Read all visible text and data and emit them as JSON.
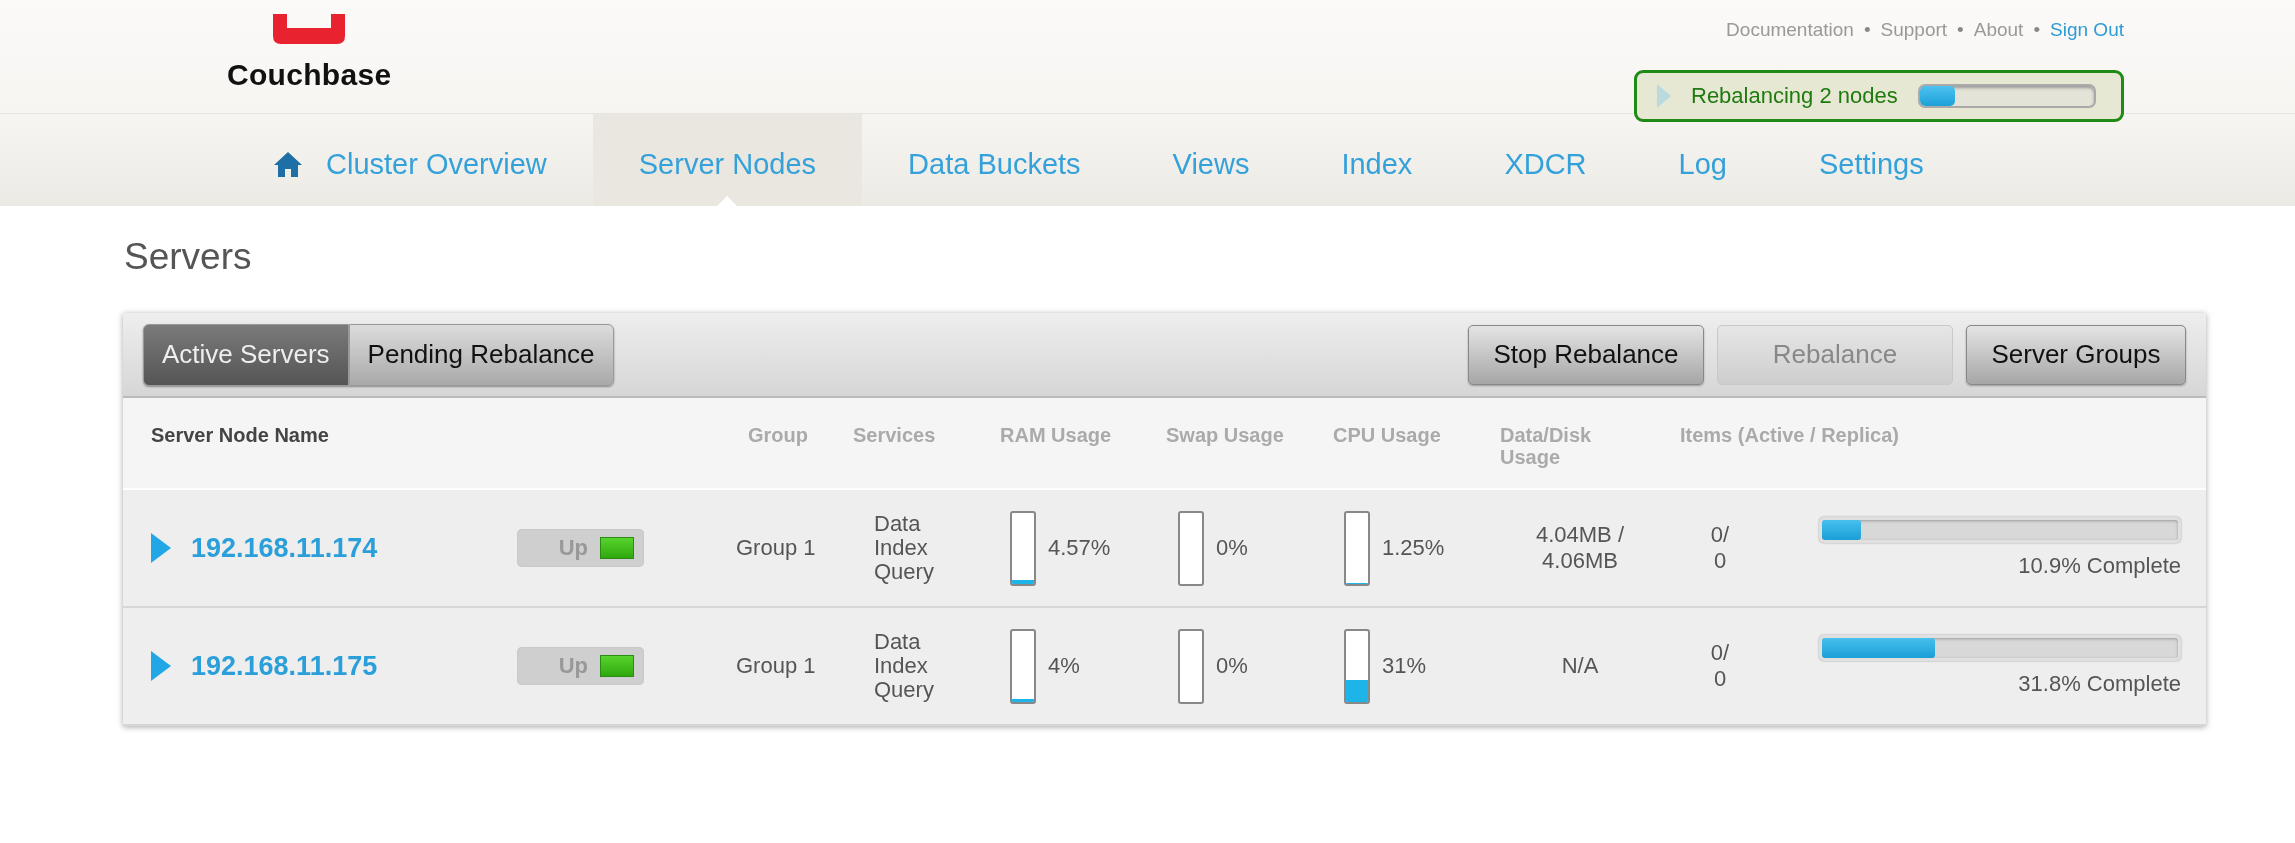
{
  "logo": {
    "text": "Couchbase"
  },
  "top_links": [
    {
      "label": "Documentation",
      "kind": "plain"
    },
    {
      "label": "•",
      "kind": "separator"
    },
    {
      "label": "Support",
      "kind": "plain"
    },
    {
      "label": "•",
      "kind": "separator"
    },
    {
      "label": "About",
      "kind": "plain"
    },
    {
      "label": "•",
      "kind": "separator"
    },
    {
      "label": "Sign Out",
      "kind": "accent"
    }
  ],
  "rebalance_status": {
    "text": "Rebalancing 2 nodes",
    "level": 0.2
  },
  "nav": [
    {
      "label": "Cluster Overview",
      "kind": "home",
      "selected": false
    },
    {
      "label": "Server Nodes",
      "kind": "plain",
      "selected": true
    },
    {
      "label": "Data Buckets",
      "kind": "plain",
      "selected": false
    },
    {
      "label": "Views",
      "kind": "plain",
      "selected": false
    },
    {
      "label": "Index",
      "kind": "plain",
      "selected": false
    },
    {
      "label": "XDCR",
      "kind": "plain",
      "selected": false
    },
    {
      "label": "Log",
      "kind": "plain",
      "selected": false
    },
    {
      "label": "Settings",
      "kind": "plain",
      "selected": false
    }
  ],
  "page_title": "Servers",
  "view_tabs": [
    {
      "label": "Active Servers",
      "selected": true
    },
    {
      "label": "Pending Rebalance",
      "selected": false
    }
  ],
  "buttons": [
    {
      "label": "Stop Rebalance",
      "disabled": false
    },
    {
      "label": "Rebalance",
      "disabled": true
    },
    {
      "label": "Server Groups",
      "disabled": false
    }
  ],
  "table": {
    "columns": [
      {
        "label": "Server Node Name",
        "kind": "name"
      },
      {
        "label": "Group",
        "kind": "group"
      },
      {
        "label": "Services",
        "kind": "services"
      },
      {
        "label": "RAM Usage",
        "kind": "ram"
      },
      {
        "label": "Swap Usage",
        "kind": "swap"
      },
      {
        "label": "CPU Usage",
        "kind": "cpu"
      },
      {
        "label": "Data/Disk Usage",
        "kind": "data"
      },
      {
        "label": "Items (Active / Replica)",
        "kind": "items"
      }
    ],
    "rows": [
      {
        "name": "192.168.11.174",
        "expanded": false,
        "status": "Up",
        "group": "Group 1",
        "services": [
          "Data",
          "Index",
          "Query"
        ],
        "ram": {
          "level": 0.0457,
          "reading": "4.57%"
        },
        "swap": {
          "reading": "0%"
        },
        "cpu": {
          "level": 0.0125,
          "reading": "1.25%"
        },
        "data_disk": [
          "4.04MB /",
          "4.06MB"
        ],
        "items": [
          "0/",
          "0"
        ],
        "progress": {
          "level": 0.109,
          "text": "10.9% Complete"
        }
      },
      {
        "name": "192.168.11.175",
        "expanded": false,
        "status": "Up",
        "group": "Group 1",
        "services": [
          "Data",
          "Index",
          "Query"
        ],
        "ram": {
          "level": 0.04,
          "reading": "4%"
        },
        "swap": {
          "reading": "0%"
        },
        "cpu": {
          "level": 0.31,
          "reading": "31%"
        },
        "data_disk": [
          "N/A"
        ],
        "items": [
          "0/",
          "0"
        ],
        "progress": {
          "level": 0.318,
          "text": "31.8% Complete"
        }
      }
    ]
  }
}
